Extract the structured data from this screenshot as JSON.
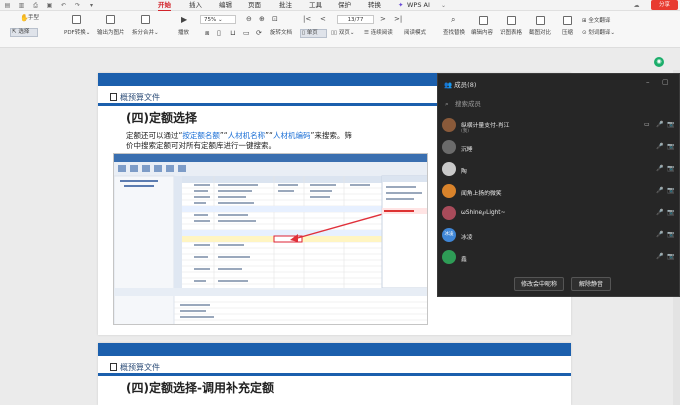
{
  "titlebar": {
    "tabs": [
      "开始",
      "插入",
      "编辑",
      "页面",
      "批注",
      "工具",
      "保护",
      "转换"
    ],
    "active_tab": "开始",
    "wps_ai": "WPS AI",
    "share": "分享"
  },
  "ribbon": {
    "hand_tool": "手型",
    "select_tool": "选择",
    "pdf_convert": "PDF转换",
    "export_image": "输出为图片",
    "split_merge": "拆分合并",
    "play": "播放",
    "zoom": "75%",
    "page_indicator": "13/77",
    "rotate_doc": "旋转文档",
    "single_page": "单页",
    "double_page": "双页",
    "continuous": "连续阅读",
    "read_mode": "阅读模式",
    "find_replace": "查找替换",
    "edit_content": "编辑内容",
    "recognize_table": "识图表格",
    "screenshot_compare": "截图对比",
    "compress": "压缩",
    "full_translate": "全文翻译",
    "word_translate": "划词翻译"
  },
  "document": {
    "section_label": "概预算文件",
    "heading1": "(四)定额选择",
    "para_line1_prefix": "定额还可以通过“",
    "link1": "按定额名额",
    "sep1": "”“",
    "link2": "人材机名称",
    "sep2": "”“",
    "link3": "人材机编码",
    "para_line1_suffix": "”来搜索。筛",
    "para_line2": "价中搜索定额可对所有定额库进行一键搜索。",
    "section_label2": "概预算文件",
    "heading2": "(四)定额选择-调用补充定额"
  },
  "members_panel": {
    "title": "成员(8)",
    "search_placeholder": "搜索成员",
    "members": [
      {
        "name": "纵横计量支付-肖江",
        "sub": "(我)",
        "color": "#8a5a3a"
      },
      {
        "name": "沉睡",
        "color": "#6b6b6b"
      },
      {
        "name": "陶",
        "color": "#c9c9c9"
      },
      {
        "name": "闻角上扬的微笑",
        "color": "#d9832b"
      },
      {
        "name": "ωShine℘Light~",
        "color": "#a84b5a"
      },
      {
        "name": "冰凌",
        "avatar_text": "冰凌",
        "color": "#3f86d6"
      },
      {
        "name": "鑫",
        "color": "#2e9c56"
      }
    ],
    "btn_rename": "修改会中昵称",
    "btn_unmute": "解除静音"
  }
}
